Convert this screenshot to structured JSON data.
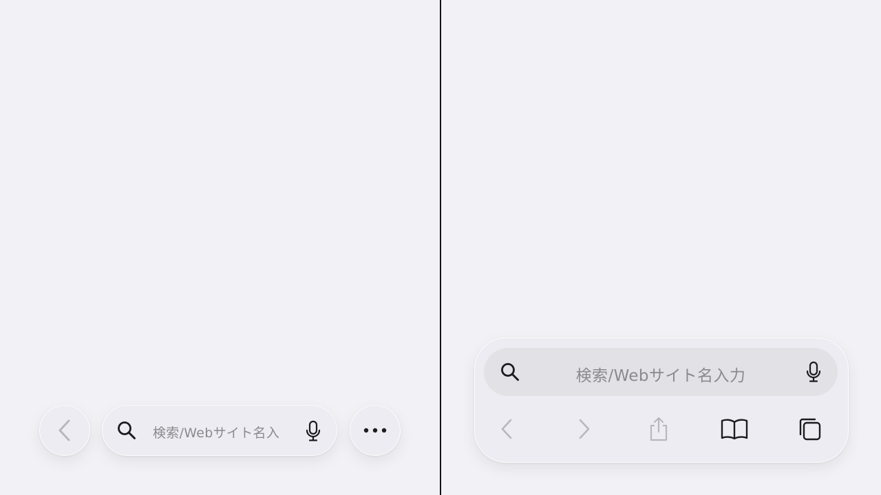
{
  "left_pane": {
    "search": {
      "placeholder": "検索/Webサイト名入"
    },
    "icons": {
      "back": "chevron-left-icon",
      "search": "magnifier-icon",
      "mic": "microphone-icon",
      "more": "ellipsis-icon"
    }
  },
  "right_pane": {
    "search": {
      "placeholder": "検索/Webサイト名入力"
    },
    "toolbar": {
      "icons": [
        "chevron-left-icon",
        "chevron-right-icon",
        "share-icon",
        "book-icon",
        "tabs-icon"
      ]
    }
  },
  "colors": {
    "background": "#f2f1f6",
    "placeholder": "#8a8a8e",
    "icon_active": "#1c1c1e",
    "icon_disabled": "#b8b8bc",
    "divider": "#111111"
  }
}
